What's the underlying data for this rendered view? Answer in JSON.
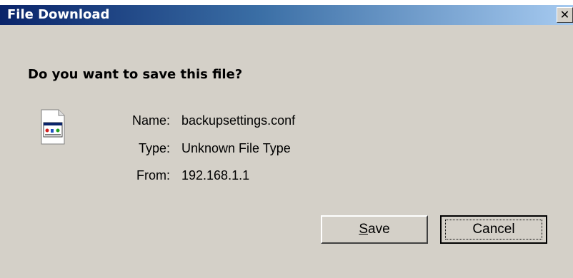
{
  "dialog": {
    "title": "File Download",
    "close_label": "✕",
    "question": "Do you want to save this file?",
    "file_icon": "file-icon",
    "info": [
      {
        "label": "Name:",
        "value": "backupsettings.conf"
      },
      {
        "label": "Type:",
        "value": "Unknown File Type"
      },
      {
        "label": "From:",
        "value": "192.168.1.1"
      }
    ],
    "buttons": {
      "save": {
        "underlined": "S",
        "rest": "ave"
      },
      "cancel": "Cancel"
    },
    "colors": {
      "titlebar_start": "#0a246a",
      "titlebar_end": "#a6caf0",
      "background": "#d4d0c8"
    }
  }
}
